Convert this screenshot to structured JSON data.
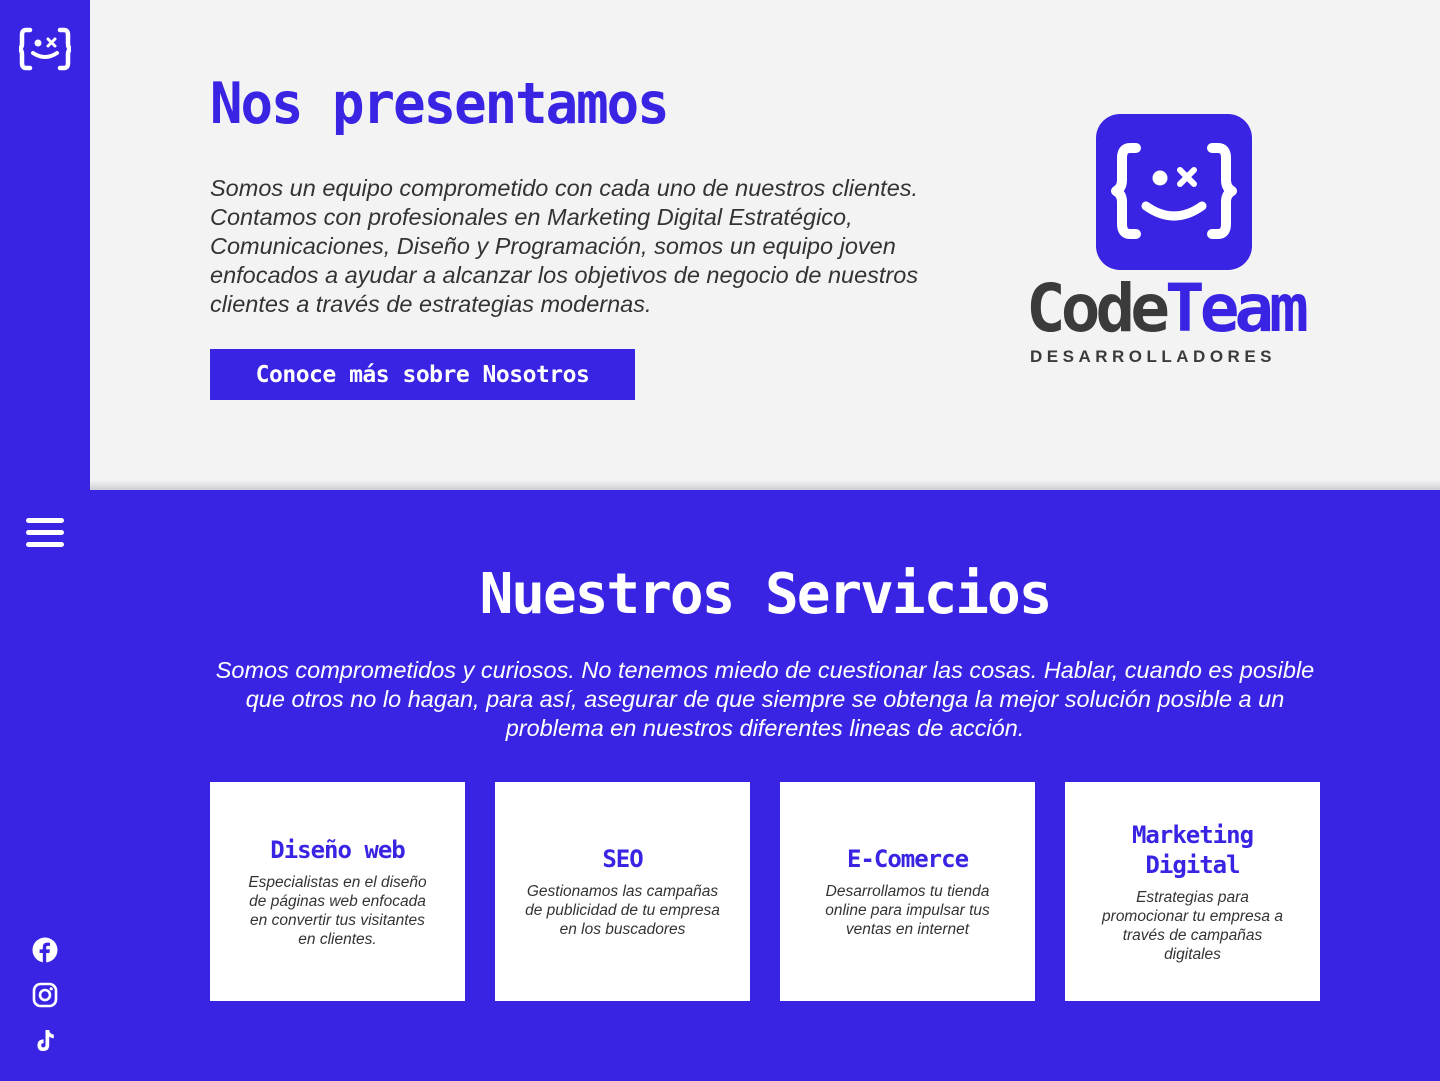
{
  "sidebar": {
    "logo_icon": "codeteam-face-icon",
    "menu_icon": "hamburger-icon",
    "social": [
      {
        "name": "facebook-icon"
      },
      {
        "name": "instagram-icon"
      },
      {
        "name": "tiktok-icon"
      }
    ]
  },
  "about": {
    "title": "Nos presentamos",
    "text": "Somos un equipo comprometido con cada uno de nuestros clientes. Contamos con profesionales en Marketing Digital Estratégico, Comunicaciones, Diseño y Programación, somos un equipo joven enfocados a ayudar a alcanzar los objetivos de negocio de nuestros clientes a través de estrategias modernas.",
    "cta_label": "Conoce más sobre Nosotros"
  },
  "brand": {
    "name_part1": "Code",
    "name_part2": "Team",
    "subtitle": "DESARROLLADORES"
  },
  "services": {
    "title": "Nuestros Servicios",
    "text": "Somos comprometidos y curiosos. No tenemos miedo de cuestionar las cosas. Hablar, cuando es posible que otros no lo hagan, para así, asegurar de que siempre se obtenga la mejor solución posible a un problema en nuestros diferentes lineas de acción.",
    "cards": [
      {
        "title": "Diseño web",
        "text": "Especialistas en el diseño de páginas web enfocada en convertir tus visitantes en clientes."
      },
      {
        "title": "SEO",
        "text": "Gestionamos las campañas de publicidad de tu empresa en los buscadores"
      },
      {
        "title": "E-Comerce",
        "text": "Desarrollamos tu tienda online para impulsar tus ventas en internet"
      },
      {
        "title": "Marketing Digital",
        "text": "Estrategias para promocionar tu empresa a través de campañas digitales"
      }
    ]
  },
  "colors": {
    "brand": "#3a24e3",
    "light_bg": "#f3f3f4",
    "dark_text": "#3b3b3b"
  }
}
